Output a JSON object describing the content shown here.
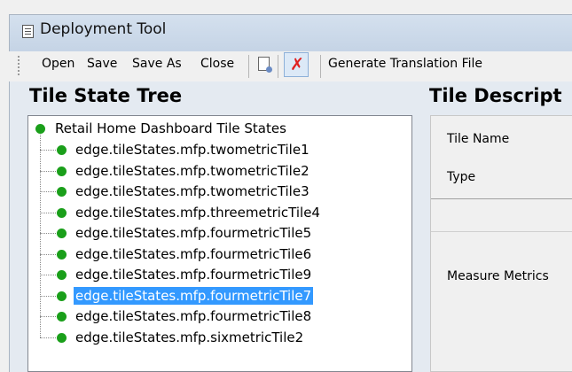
{
  "window": {
    "title": "Deployment Tool"
  },
  "menu": {
    "open": "Open",
    "save": "Save",
    "save_as": "Save As",
    "close": "Close",
    "generate_translation": "Generate Translation File",
    "icons": [
      "document-gear-icon",
      "delete-x-icon"
    ]
  },
  "tree": {
    "heading": "Tile State Tree",
    "root": "Retail Home Dashboard Tile States",
    "items": [
      "edge.tileStates.mfp.twometricTile1",
      "edge.tileStates.mfp.twometricTile2",
      "edge.tileStates.mfp.twometricTile3",
      "edge.tileStates.mfp.threemetricTile4",
      "edge.tileStates.mfp.fourmetricTile5",
      "edge.tileStates.mfp.fourmetricTile6",
      "edge.tileStates.mfp.fourmetricTile9",
      "edge.tileStates.mfp.fourmetricTile7",
      "edge.tileStates.mfp.fourmetricTile8",
      "edge.tileStates.mfp.sixmetricTile2"
    ],
    "selected_item": "edge.tileStates.mfp.fourmetricTile7"
  },
  "description": {
    "heading": "Tile Descript",
    "tile_name_label": "Tile Name",
    "type_label": "Type",
    "measure_metrics_label": "Measure Metrics"
  },
  "colors": {
    "node_dot": "#1a9f1a",
    "selection": "#3399ff",
    "delete_icon": "#e02020"
  }
}
